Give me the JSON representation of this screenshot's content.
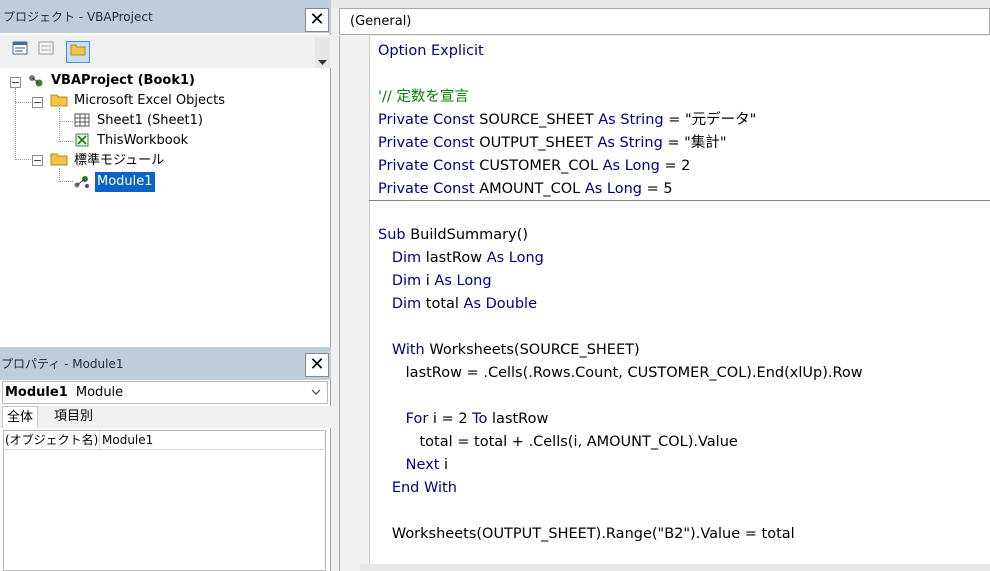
{
  "project_pane": {
    "title": "プロジェクト - VBAProject",
    "close_label": "✕",
    "tree": {
      "root_label": "VBAProject (Book1)",
      "folder_excel_objects": "Microsoft Excel Objects",
      "sheet1": "Sheet1 (Sheet1)",
      "this_workbook": "ThisWorkbook",
      "folder_modules": "標準モジュール",
      "module1": "Module1"
    }
  },
  "properties_pane": {
    "title": "プロパティ - Module1",
    "close_label": "✕",
    "object_combo_name": "Module1",
    "object_combo_type": "Module",
    "tabs": [
      "全体",
      "項目別"
    ],
    "rows": [
      {
        "name": "(オブジェクト名)",
        "value": "Module1"
      }
    ]
  },
  "code_window": {
    "procedure_combo": "(General)",
    "lines": [
      {
        "y": 0,
        "parts": [
          [
            "kw",
            "Option Explicit"
          ]
        ]
      },
      {
        "y": 2,
        "parts": [
          [
            "cm",
            "'// 定数を宣言"
          ]
        ]
      },
      {
        "y": 3,
        "parts": [
          [
            "kw",
            "Private Const "
          ],
          [
            "tx",
            "SOURCE_SHEET "
          ],
          [
            "kw",
            "As String"
          ],
          [
            "tx",
            " = \"元データ\""
          ]
        ]
      },
      {
        "y": 4,
        "parts": [
          [
            "kw",
            "Private Const "
          ],
          [
            "tx",
            "OUTPUT_SHEET "
          ],
          [
            "kw",
            "As String"
          ],
          [
            "tx",
            " = \"集計\""
          ]
        ]
      },
      {
        "y": 5,
        "parts": [
          [
            "kw",
            "Private Const "
          ],
          [
            "tx",
            "CUSTOMER_COL "
          ],
          [
            "kw",
            "As Long"
          ],
          [
            "tx",
            " = 2"
          ]
        ]
      },
      {
        "y": 6,
        "parts": [
          [
            "kw",
            "Private Const "
          ],
          [
            "tx",
            "AMOUNT_COL "
          ],
          [
            "kw",
            "As Long"
          ],
          [
            "tx",
            " = 5"
          ]
        ]
      },
      {
        "y": 8,
        "parts": [
          [
            "kw",
            "Sub "
          ],
          [
            "tx",
            "BuildSummary()"
          ]
        ]
      },
      {
        "y": 9,
        "parts": [
          [
            "tx",
            "   "
          ],
          [
            "kw",
            "Dim "
          ],
          [
            "tx",
            "lastRow "
          ],
          [
            "kw",
            "As Long"
          ]
        ]
      },
      {
        "y": 10,
        "parts": [
          [
            "tx",
            "   "
          ],
          [
            "kw",
            "Dim "
          ],
          [
            "tx",
            "i "
          ],
          [
            "kw",
            "As Long"
          ]
        ]
      },
      {
        "y": 11,
        "parts": [
          [
            "tx",
            "   "
          ],
          [
            "kw",
            "Dim "
          ],
          [
            "tx",
            "total "
          ],
          [
            "kw",
            "As Double"
          ]
        ]
      },
      {
        "y": 13,
        "parts": [
          [
            "tx",
            "   "
          ],
          [
            "kw",
            "With "
          ],
          [
            "tx",
            "Worksheets(SOURCE_SHEET)"
          ]
        ]
      },
      {
        "y": 14,
        "parts": [
          [
            "tx",
            "      lastRow = .Cells(.Rows.Count, CUSTOMER_COL).End(xlUp).Row"
          ]
        ]
      },
      {
        "y": 16,
        "parts": [
          [
            "tx",
            "      "
          ],
          [
            "kw",
            "For "
          ],
          [
            "tx",
            "i = 2 "
          ],
          [
            "kw",
            "To "
          ],
          [
            "tx",
            "lastRow"
          ]
        ]
      },
      {
        "y": 17,
        "parts": [
          [
            "tx",
            "         total = total + .Cells(i, AMOUNT_COL).Value"
          ]
        ]
      },
      {
        "y": 18,
        "parts": [
          [
            "tx",
            "      "
          ],
          [
            "kw",
            "Next "
          ],
          [
            "tx",
            "i"
          ]
        ]
      },
      {
        "y": 19,
        "parts": [
          [
            "tx",
            "   "
          ],
          [
            "kw",
            "End With"
          ]
        ]
      },
      {
        "y": 21,
        "parts": [
          [
            "tx",
            "   Worksheets(OUTPUT_SHEET).Range(\"B2\").Value = total"
          ]
        ]
      }
    ]
  }
}
